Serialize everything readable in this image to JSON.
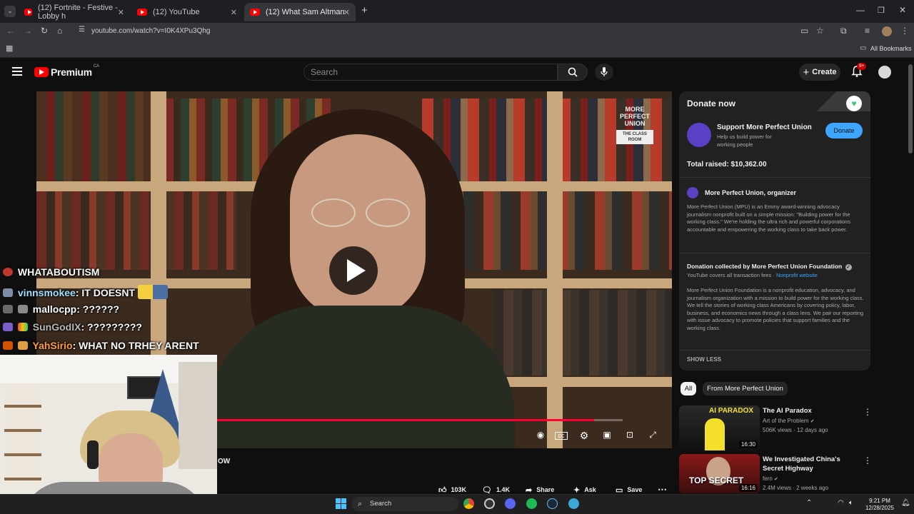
{
  "browser": {
    "tabs": [
      {
        "label": "(12) Fortnite - Festive - Lobby h"
      },
      {
        "label": "(12) YouTube"
      },
      {
        "label": "(12) What Sam Altman Doesn't"
      }
    ],
    "new_tab": "+",
    "url": "youtube.com/watch?v=I0K4XPu3Qhg",
    "bookmarks_label": "All Bookmarks"
  },
  "youtube": {
    "logo_text": "Premium",
    "region": "CA",
    "search_placeholder": "Search",
    "create_label": "Create",
    "notif_count": "9+"
  },
  "video": {
    "watermark_line1": "MORE",
    "watermark_line2": "PERFECT",
    "watermark_line3": "UNION",
    "watermark_sub": "THE CLASS ROOM",
    "progress": 0.93,
    "title_fragment": "OW"
  },
  "actions": {
    "likes": "103K",
    "comments": "1.4K",
    "share": "Share",
    "ask": "Ask",
    "save": "Save"
  },
  "donate": {
    "heading": "Donate now",
    "org_name": "Support More Perfect Union",
    "org_tagline": "Help us build power for working people",
    "donate_button": "Donate",
    "total_raised": "Total raised: $10,362.00",
    "organizer": "More Perfect Union, organizer",
    "organizer_desc": "More Perfect Union (MPU) is an Emmy award-winning advocacy journalism nonprofit built on a simple mission: \"Building power for the working class.\" We're holding the ultra rich and powerful corporations accountable and empowering the working class to take back power.",
    "collected_by": "Donation collected by More Perfect Union Foundation",
    "fees_note": "YouTube covers all transaction fees",
    "nonprofit_link": "Nonprofit website",
    "foundation_desc": "More Perfect Union Foundation is a nonprofit education, advocacy, and journalism organization with a mission to build power for the working class. We tell the stories of working class Americans by covering policy, labor, business, and economics news through a class lens. We pair our reporting with issue advocacy to promote policies that support families and the working class.",
    "show_less": "SHOW LESS"
  },
  "chips": [
    {
      "label": "All"
    },
    {
      "label": "From More Perfect Union"
    }
  ],
  "recommendations": [
    {
      "title": "The AI Paradox",
      "channel": "Art of the Problem",
      "meta": "506K views · 12 days ago",
      "duration": "16:30",
      "thumb_text": "AI PARADOX"
    },
    {
      "title": "We Investigated China's Secret Highway",
      "channel": "fern",
      "meta": "2.4M views · 2 weeks ago",
      "duration": "16:16",
      "thumb_text": "TOP SECRET"
    }
  ],
  "chat": [
    {
      "user": "",
      "text": "WHATABOUTISM",
      "color": "#ffffff",
      "badge": "#c0392b"
    },
    {
      "user": "vinnsmokee",
      "text": ": IT DOESNT",
      "color": "#ffffff",
      "badge": "#7d8da6"
    },
    {
      "user": "mallocpp",
      "text": ": ??????",
      "color": "#ffffff",
      "badge": "#6a6a6a"
    },
    {
      "user": "SunGodIX",
      "text": ": ?????????",
      "color": "#b8b8b8",
      "badge": "#7a5ec8"
    },
    {
      "user": "YahSirio",
      "text": ": WHAT NO TRHEY ARENT",
      "color": "#ff9e3b",
      "badge": "#d35400"
    }
  ],
  "taskbar": {
    "search_label": "Search",
    "time": "9:21 PM",
    "date": "12/28/2025"
  },
  "colors": {
    "accent_red": "#ff0033",
    "donate_blue": "#3ea6ff",
    "background": "#0f0f0f"
  }
}
